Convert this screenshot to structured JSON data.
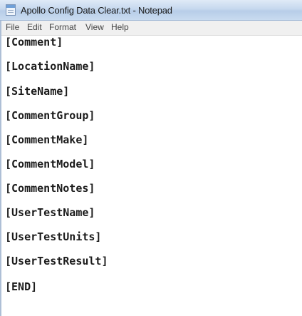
{
  "window": {
    "title": "Apollo Config Data Clear.txt - Notepad"
  },
  "menu": [
    "File",
    "Edit",
    "Format",
    "View",
    "Help"
  ],
  "content": {
    "lines": [
      "[Comment]",
      "[LocationName]",
      "[SiteName]",
      "[CommentGroup]",
      "[CommentMake]",
      "[CommentModel]",
      "[CommentNotes]",
      "[UserTestName]",
      "[UserTestUnits]",
      "[UserTestResult]",
      "[END]"
    ]
  },
  "icons": {
    "app": "notepad-icon"
  }
}
